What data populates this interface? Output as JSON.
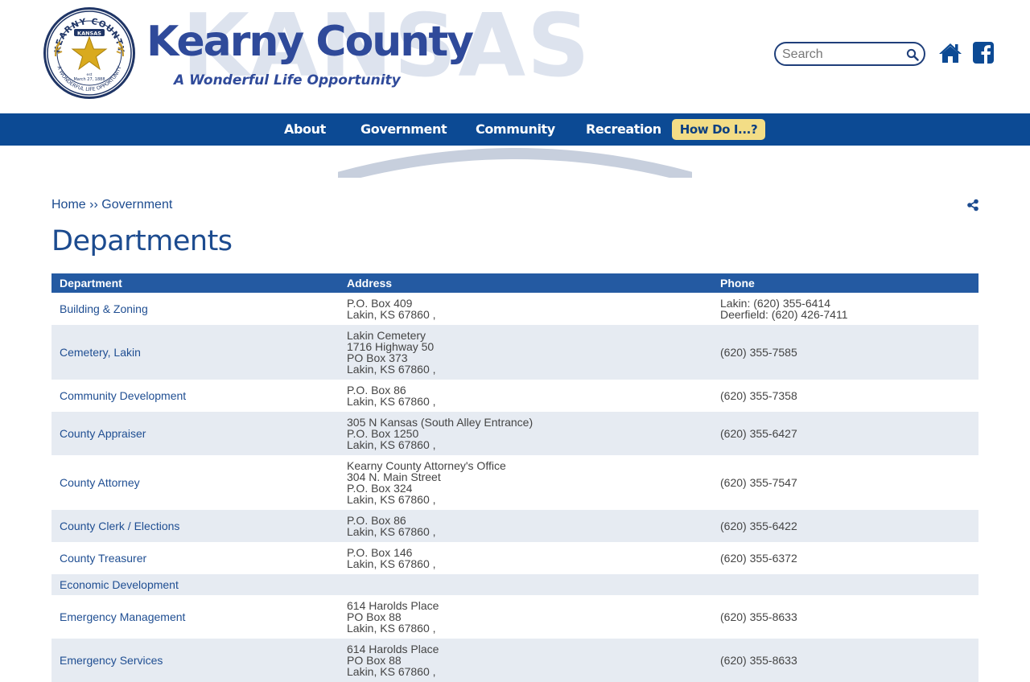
{
  "header": {
    "site_title": "Kearny County",
    "tagline": "A Wonderful Life Opportunity",
    "watermark": "KANSAS",
    "seal": {
      "top_text": "KEARNY COUNTY",
      "state": "KANSAS",
      "est": "est",
      "date": "March 27, 1888",
      "bottom_text": "A WONDERFUL LIFE OPPORTUNITY"
    },
    "search": {
      "placeholder": "Search",
      "value": ""
    },
    "icons": {
      "search": "search-icon",
      "home": "home-icon",
      "facebook": "facebook-icon"
    }
  },
  "nav": {
    "items": [
      {
        "label": "About"
      },
      {
        "label": "Government"
      },
      {
        "label": "Community"
      },
      {
        "label": "Recreation"
      }
    ],
    "cta": "How Do I...?"
  },
  "breadcrumb": {
    "home": "Home",
    "separator": "››",
    "current": "Government"
  },
  "page": {
    "title": "Departments"
  },
  "table": {
    "headers": [
      "Department",
      "Address",
      "Phone"
    ],
    "rows": [
      {
        "department": "Building & Zoning",
        "address": [
          "P.O. Box 409",
          "Lakin, KS 67860 ,"
        ],
        "phone": [
          "Lakin: (620) 355-6414",
          "Deerfield: (620) 426-7411"
        ]
      },
      {
        "department": "Cemetery, Lakin",
        "address": [
          "Lakin Cemetery",
          "1716 Highway 50",
          "PO Box 373",
          "Lakin, KS 67860 ,"
        ],
        "phone": [
          "(620) 355-7585"
        ]
      },
      {
        "department": "Community Development",
        "address": [
          "P.O. Box 86",
          "Lakin, KS 67860 ,"
        ],
        "phone": [
          "(620) 355-7358"
        ]
      },
      {
        "department": "County Appraiser",
        "address": [
          "305 N Kansas (South Alley Entrance)",
          "P.O. Box 1250",
          "Lakin, KS 67860 ,"
        ],
        "phone": [
          "(620) 355-6427"
        ]
      },
      {
        "department": "County Attorney",
        "address": [
          "Kearny County Attorney's Office",
          "304 N. Main Street",
          "P.O. Box 324",
          "Lakin, KS 67860 ,"
        ],
        "phone": [
          "(620) 355-7547"
        ]
      },
      {
        "department": "County Clerk / Elections",
        "address": [
          "P.O. Box 86",
          "Lakin, KS 67860 ,"
        ],
        "phone": [
          "(620) 355-6422"
        ]
      },
      {
        "department": "County Treasurer",
        "address": [
          "P.O. Box 146",
          "Lakin, KS 67860 ,"
        ],
        "phone": [
          "(620) 355-6372"
        ]
      },
      {
        "department": "Economic Development",
        "address": [],
        "phone": []
      },
      {
        "department": "Emergency Management",
        "address": [
          "614 Harolds Place",
          "PO Box 88",
          "Lakin, KS 67860 ,"
        ],
        "phone": [
          "(620) 355-8633"
        ]
      },
      {
        "department": "Emergency Services",
        "address": [
          "614 Harolds Place",
          "PO Box 88",
          "Lakin, KS 67860 ,"
        ],
        "phone": [
          "(620) 355-8633"
        ]
      }
    ]
  },
  "colors": {
    "brand_blue": "#2f4a9a",
    "nav_blue": "#0c4a94",
    "table_header": "#245aa2",
    "cta_yellow": "#f3dd86",
    "row_alt": "#e6ebf2"
  }
}
